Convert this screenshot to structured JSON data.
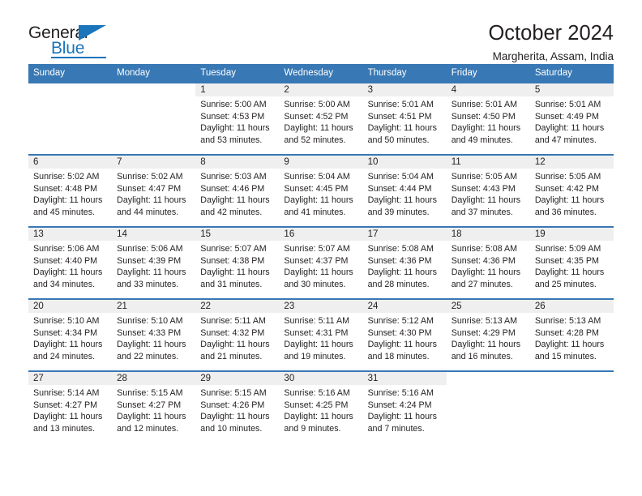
{
  "brand": {
    "name_part1": "General",
    "name_part2": "Blue",
    "triangle_icon": "triangle-icon"
  },
  "header": {
    "title": "October 2024",
    "subtitle": "Margherita, Assam, India"
  },
  "colors": {
    "header_blue": "#3878b4",
    "brand_blue": "#1b75bb",
    "daynum_band": "#efefef",
    "text": "#231f20"
  },
  "calendar": {
    "weekday_headers": [
      "Sunday",
      "Monday",
      "Tuesday",
      "Wednesday",
      "Thursday",
      "Friday",
      "Saturday"
    ],
    "weeks": [
      [
        {
          "day": "",
          "blank": true
        },
        {
          "day": "",
          "blank": true
        },
        {
          "day": "1",
          "sunrise": "Sunrise: 5:00 AM",
          "sunset": "Sunset: 4:53 PM",
          "daylight": "Daylight: 11 hours and 53 minutes."
        },
        {
          "day": "2",
          "sunrise": "Sunrise: 5:00 AM",
          "sunset": "Sunset: 4:52 PM",
          "daylight": "Daylight: 11 hours and 52 minutes."
        },
        {
          "day": "3",
          "sunrise": "Sunrise: 5:01 AM",
          "sunset": "Sunset: 4:51 PM",
          "daylight": "Daylight: 11 hours and 50 minutes."
        },
        {
          "day": "4",
          "sunrise": "Sunrise: 5:01 AM",
          "sunset": "Sunset: 4:50 PM",
          "daylight": "Daylight: 11 hours and 49 minutes."
        },
        {
          "day": "5",
          "sunrise": "Sunrise: 5:01 AM",
          "sunset": "Sunset: 4:49 PM",
          "daylight": "Daylight: 11 hours and 47 minutes."
        }
      ],
      [
        {
          "day": "6",
          "sunrise": "Sunrise: 5:02 AM",
          "sunset": "Sunset: 4:48 PM",
          "daylight": "Daylight: 11 hours and 45 minutes."
        },
        {
          "day": "7",
          "sunrise": "Sunrise: 5:02 AM",
          "sunset": "Sunset: 4:47 PM",
          "daylight": "Daylight: 11 hours and 44 minutes."
        },
        {
          "day": "8",
          "sunrise": "Sunrise: 5:03 AM",
          "sunset": "Sunset: 4:46 PM",
          "daylight": "Daylight: 11 hours and 42 minutes."
        },
        {
          "day": "9",
          "sunrise": "Sunrise: 5:04 AM",
          "sunset": "Sunset: 4:45 PM",
          "daylight": "Daylight: 11 hours and 41 minutes."
        },
        {
          "day": "10",
          "sunrise": "Sunrise: 5:04 AM",
          "sunset": "Sunset: 4:44 PM",
          "daylight": "Daylight: 11 hours and 39 minutes."
        },
        {
          "day": "11",
          "sunrise": "Sunrise: 5:05 AM",
          "sunset": "Sunset: 4:43 PM",
          "daylight": "Daylight: 11 hours and 37 minutes."
        },
        {
          "day": "12",
          "sunrise": "Sunrise: 5:05 AM",
          "sunset": "Sunset: 4:42 PM",
          "daylight": "Daylight: 11 hours and 36 minutes."
        }
      ],
      [
        {
          "day": "13",
          "sunrise": "Sunrise: 5:06 AM",
          "sunset": "Sunset: 4:40 PM",
          "daylight": "Daylight: 11 hours and 34 minutes."
        },
        {
          "day": "14",
          "sunrise": "Sunrise: 5:06 AM",
          "sunset": "Sunset: 4:39 PM",
          "daylight": "Daylight: 11 hours and 33 minutes."
        },
        {
          "day": "15",
          "sunrise": "Sunrise: 5:07 AM",
          "sunset": "Sunset: 4:38 PM",
          "daylight": "Daylight: 11 hours and 31 minutes."
        },
        {
          "day": "16",
          "sunrise": "Sunrise: 5:07 AM",
          "sunset": "Sunset: 4:37 PM",
          "daylight": "Daylight: 11 hours and 30 minutes."
        },
        {
          "day": "17",
          "sunrise": "Sunrise: 5:08 AM",
          "sunset": "Sunset: 4:36 PM",
          "daylight": "Daylight: 11 hours and 28 minutes."
        },
        {
          "day": "18",
          "sunrise": "Sunrise: 5:08 AM",
          "sunset": "Sunset: 4:36 PM",
          "daylight": "Daylight: 11 hours and 27 minutes."
        },
        {
          "day": "19",
          "sunrise": "Sunrise: 5:09 AM",
          "sunset": "Sunset: 4:35 PM",
          "daylight": "Daylight: 11 hours and 25 minutes."
        }
      ],
      [
        {
          "day": "20",
          "sunrise": "Sunrise: 5:10 AM",
          "sunset": "Sunset: 4:34 PM",
          "daylight": "Daylight: 11 hours and 24 minutes."
        },
        {
          "day": "21",
          "sunrise": "Sunrise: 5:10 AM",
          "sunset": "Sunset: 4:33 PM",
          "daylight": "Daylight: 11 hours and 22 minutes."
        },
        {
          "day": "22",
          "sunrise": "Sunrise: 5:11 AM",
          "sunset": "Sunset: 4:32 PM",
          "daylight": "Daylight: 11 hours and 21 minutes."
        },
        {
          "day": "23",
          "sunrise": "Sunrise: 5:11 AM",
          "sunset": "Sunset: 4:31 PM",
          "daylight": "Daylight: 11 hours and 19 minutes."
        },
        {
          "day": "24",
          "sunrise": "Sunrise: 5:12 AM",
          "sunset": "Sunset: 4:30 PM",
          "daylight": "Daylight: 11 hours and 18 minutes."
        },
        {
          "day": "25",
          "sunrise": "Sunrise: 5:13 AM",
          "sunset": "Sunset: 4:29 PM",
          "daylight": "Daylight: 11 hours and 16 minutes."
        },
        {
          "day": "26",
          "sunrise": "Sunrise: 5:13 AM",
          "sunset": "Sunset: 4:28 PM",
          "daylight": "Daylight: 11 hours and 15 minutes."
        }
      ],
      [
        {
          "day": "27",
          "sunrise": "Sunrise: 5:14 AM",
          "sunset": "Sunset: 4:27 PM",
          "daylight": "Daylight: 11 hours and 13 minutes."
        },
        {
          "day": "28",
          "sunrise": "Sunrise: 5:15 AM",
          "sunset": "Sunset: 4:27 PM",
          "daylight": "Daylight: 11 hours and 12 minutes."
        },
        {
          "day": "29",
          "sunrise": "Sunrise: 5:15 AM",
          "sunset": "Sunset: 4:26 PM",
          "daylight": "Daylight: 11 hours and 10 minutes."
        },
        {
          "day": "30",
          "sunrise": "Sunrise: 5:16 AM",
          "sunset": "Sunset: 4:25 PM",
          "daylight": "Daylight: 11 hours and 9 minutes."
        },
        {
          "day": "31",
          "sunrise": "Sunrise: 5:16 AM",
          "sunset": "Sunset: 4:24 PM",
          "daylight": "Daylight: 11 hours and 7 minutes."
        },
        {
          "day": "",
          "blank": true
        },
        {
          "day": "",
          "blank": true
        }
      ]
    ]
  }
}
